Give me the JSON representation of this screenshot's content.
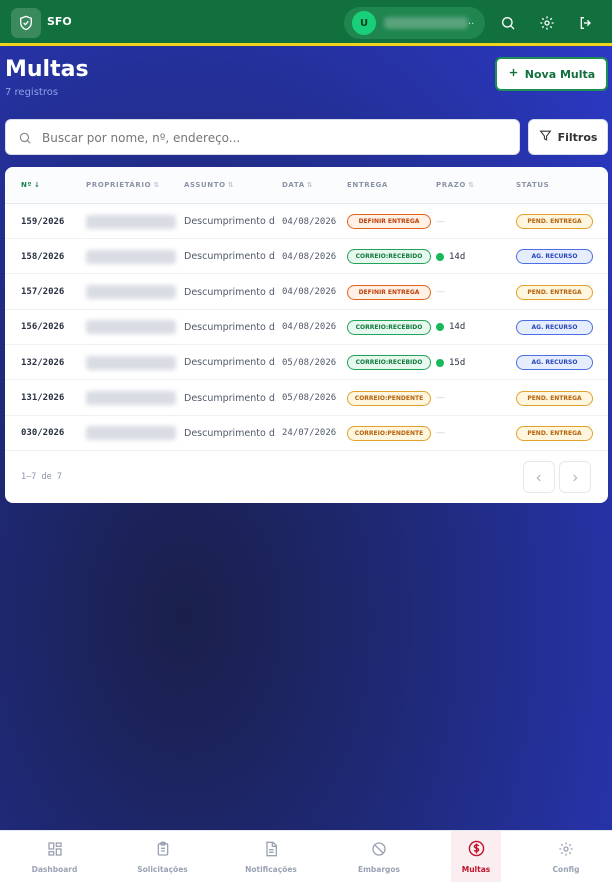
{
  "header": {
    "brand": "SFO",
    "user_initial": "U",
    "user_suffix": ".."
  },
  "page": {
    "title": "Multas",
    "count": "7 registros",
    "new_button": "Nova Multa"
  },
  "search": {
    "placeholder": "Buscar por nome, nº, endereço...",
    "filter_label": "Filtros"
  },
  "table": {
    "columns": [
      "Nº",
      "Proprietário",
      "Assunto",
      "Data",
      "Entrega",
      "Prazo",
      "Status"
    ],
    "rows": [
      {
        "num": "159/2026",
        "subject": "Descumprimento d...",
        "date": "04/08/2026",
        "entrega": "DEFINIR ENTREGA",
        "prazo": "—",
        "status": "PEND. ENTREGA"
      },
      {
        "num": "158/2026",
        "subject": "Descumprimento d...",
        "date": "04/08/2026",
        "entrega": "CORREIO:RECEBIDO",
        "prazo": "14d",
        "status": "AG. RECURSO"
      },
      {
        "num": "157/2026",
        "subject": "Descumprimento d...",
        "date": "04/08/2026",
        "entrega": "DEFINIR ENTREGA",
        "prazo": "—",
        "status": "PEND. ENTREGA"
      },
      {
        "num": "156/2026",
        "subject": "Descumprimento d...",
        "date": "04/08/2026",
        "entrega": "CORREIO:RECEBIDO",
        "prazo": "14d",
        "status": "AG. RECURSO"
      },
      {
        "num": "132/2026",
        "subject": "Descumprimento d...",
        "date": "05/08/2026",
        "entrega": "CORREIO:RECEBIDO",
        "prazo": "15d",
        "status": "AG. RECURSO"
      },
      {
        "num": "131/2026",
        "subject": "Descumprimento d...",
        "date": "05/08/2026",
        "entrega": "CORREIO:PENDENTE",
        "prazo": "—",
        "status": "PEND. ENTREGA"
      },
      {
        "num": "030/2026",
        "subject": "Descumprimento d...",
        "date": "24/07/2026",
        "entrega": "CORREIO:PENDENTE",
        "prazo": "—",
        "status": "PEND. ENTREGA"
      }
    ]
  },
  "pagination": {
    "text": "1–7 de 7"
  },
  "nav": {
    "items": [
      "Dashboard",
      "Solicitações",
      "Notificações",
      "Embargos",
      "Multas",
      "Config"
    ],
    "active": "Multas"
  },
  "colors": {
    "primary_green": "#12703e",
    "accent_yellow": "#f2d31b",
    "active_red": "#c0132a"
  }
}
